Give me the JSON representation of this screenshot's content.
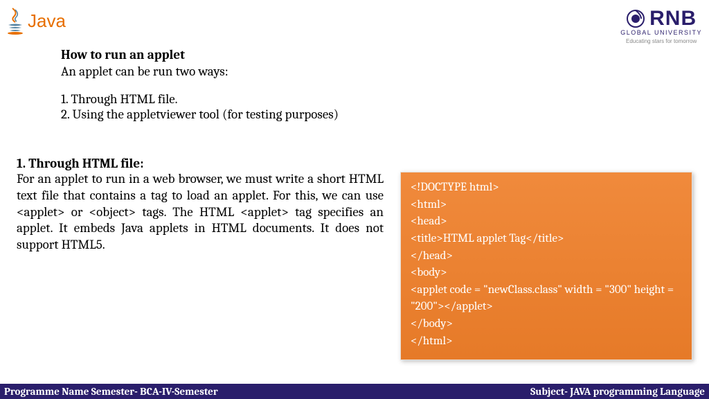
{
  "header": {
    "java_label": "Java",
    "rnb_name": "RNB",
    "rnb_sub": "GLOBAL UNIVERSITY",
    "rnb_tagline": "Educating stars for tomorrow"
  },
  "content": {
    "title": "How to run an applet",
    "intro": "An applet can be run two ways:",
    "item1": "1. Through HTML file.",
    "item2": "2. Using the appletviewer tool (for testing purposes)"
  },
  "section": {
    "subheading": "1. Through HTML file:",
    "body": "For an applet to run in a web browser, we must write a short HTML text file that contains a tag to load an applet. For this, we can use <applet> or <object> tags. The HTML <applet> tag specifies an applet. It embeds Java applets in HTML documents. It does not support HTML5."
  },
  "code": {
    "l1": "<!DOCTYPE html>",
    "l2": " <html>",
    "l3": " <head>",
    "l4": " <title>HTML applet Tag</title>",
    "l5": " </head>",
    "l6": " <body>",
    "l7": " <applet code = \"newClass.class\" width = \"300\" height = \"200\"></applet>",
    "l8": " </body>",
    "l9": " </html>"
  },
  "footer": {
    "left": "Programme Name Semester- BCA-IV-Semester",
    "right": "Subject- JAVA programming Language"
  }
}
